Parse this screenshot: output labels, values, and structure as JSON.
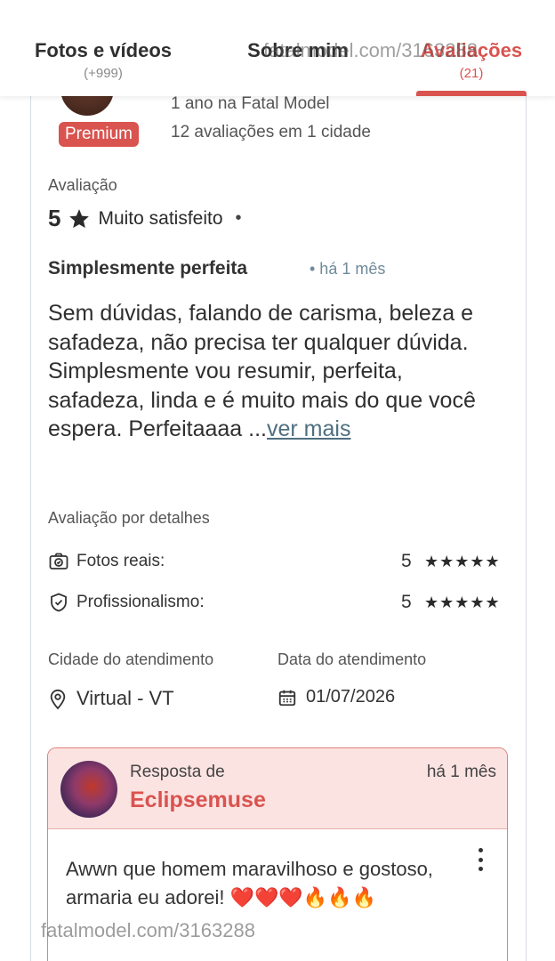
{
  "tabs": [
    {
      "label": "Fotos e vídeos",
      "count": "(+999)"
    },
    {
      "label": "Sobre mim",
      "count": ""
    },
    {
      "label": "Avaliações",
      "count": "(21)"
    }
  ],
  "watermark": "fatalmodel.com/3163288",
  "profile": {
    "meta_line1": "1 ano na Fatal Model",
    "meta_line2": "12 avaliações em 1 cidade",
    "badge": "Premium"
  },
  "review": {
    "rating_label": "Avaliação",
    "rating_value": "5",
    "rating_text": "Muito satisfeito",
    "dot": "•",
    "title": "Simplesmente perfeita",
    "time": "• há 1 mês",
    "body": "Sem dúvidas, falando de carisma, beleza e safadeza, não precisa ter qualquer dúvida. Simplesmente vou resumir, perfeita, safadeza, linda e é muito mais do que você espera. Perfeitaaaa ...",
    "more_link": "ver mais"
  },
  "details": {
    "heading": "Avaliação por detalhes",
    "items": [
      {
        "label": "Fotos reais:",
        "score": "5",
        "stars": "★★★★★",
        "icon": "camera-check-icon"
      },
      {
        "label": "Profissionalismo:",
        "score": "5",
        "stars": "★★★★★",
        "icon": "shield-check-icon"
      }
    ]
  },
  "service": {
    "city_label": "Cidade do atendimento",
    "date_label": "Data do atendimento",
    "city_value": "Virtual - VT",
    "date_value": "01/07/2026"
  },
  "response": {
    "from_label": "Resposta de",
    "name": "Eclipsemuse",
    "time": "há 1 mês",
    "text": "Awwn que homem maravilhoso e gostoso, armaria eu adorei! ❤️❤️❤️🔥🔥🔥"
  },
  "colors": {
    "accent": "#d9534f",
    "response_bg": "#fbe3e2",
    "link": "#4f6f7f"
  }
}
